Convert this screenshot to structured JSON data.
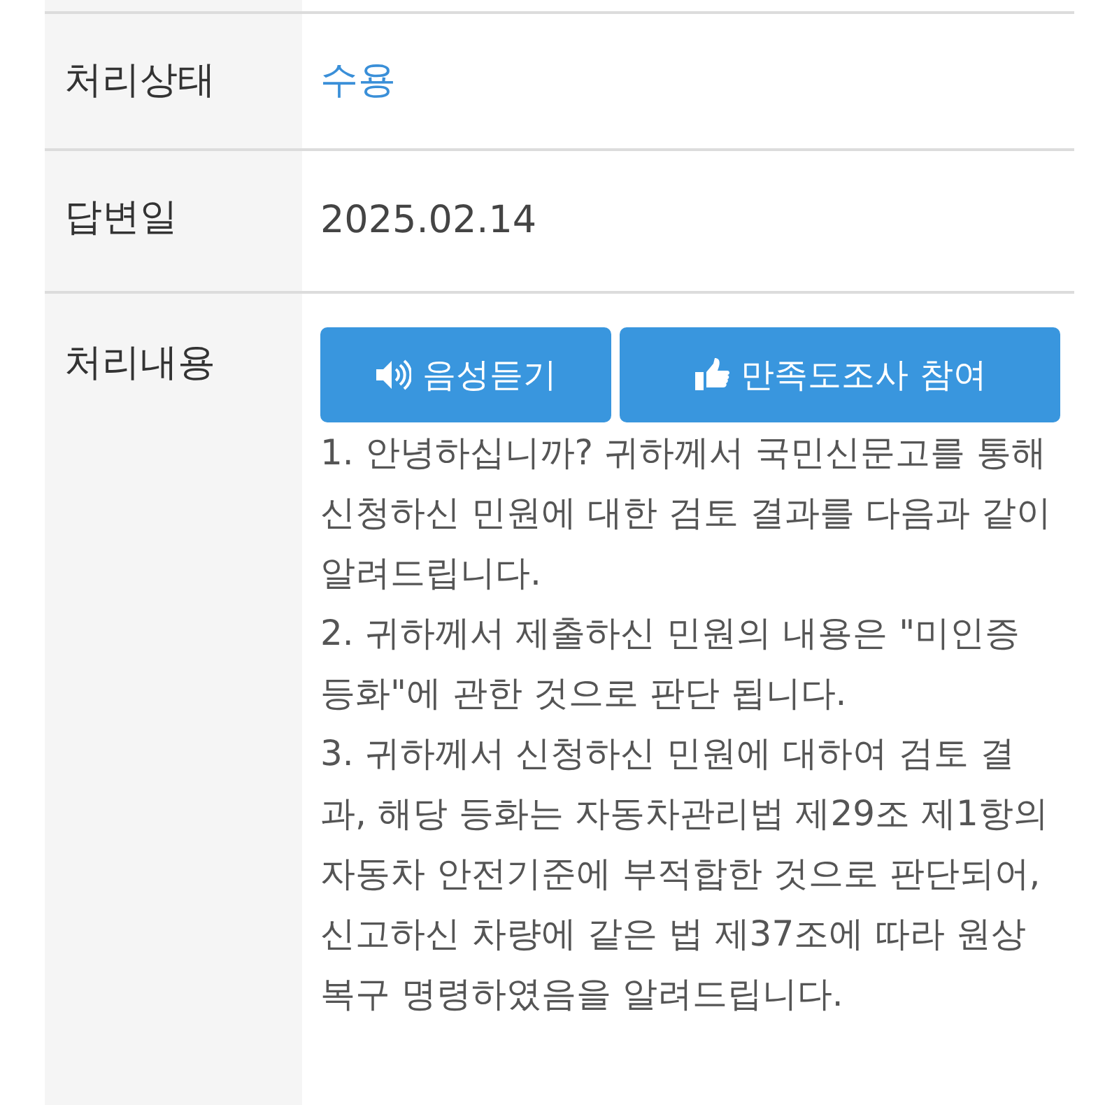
{
  "rows": [
    {
      "label": "처리상태",
      "kind": "status",
      "value": "수용"
    },
    {
      "label": "답변일",
      "kind": "text",
      "value": "2025.02.14"
    },
    {
      "label": "처리내용",
      "kind": "answer",
      "buttons": [
        {
          "label": "음성듣기",
          "kind": "listen"
        },
        {
          "label": "만족도조사 참여",
          "kind": "survey"
        }
      ],
      "paragraphs": [
        "1. 안녕하십니까? 귀하께서 국민신문고를 통해 신청하신 민원에 대한 검토 결과를 다음과 같이 알려드립니다.",
        "2. 귀하께서 제출하신 민원의 내용은 \"미인증 등화\"에 관한 것으로 판단 됩니다.",
        "3. 귀하께서 신청하신 민원에 대하여 검토 결과, 해당 등화는 자동차관리법 제29조 제1항의 자동차 안전기준에 부적합한 것으로 판단되어, 신고하신 차량에 같은 법 제37조에 따라 원상복구 명령하였음을 알려드립니다."
      ]
    }
  ]
}
